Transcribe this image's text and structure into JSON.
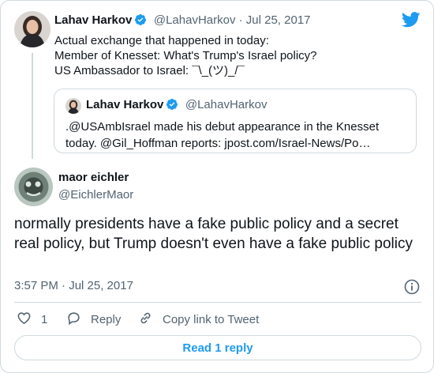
{
  "colors": {
    "accent": "#1d9bf0",
    "muted": "#536471",
    "border": "#cfd9de"
  },
  "parent": {
    "author_name": "Lahav Harkov",
    "handle_date": "@LahavHarkov · Jul 25, 2017",
    "lines": [
      "Actual exchange that happened in today:",
      "Member of Knesset: What's Trump's Israel policy?",
      "US Ambassador to Israel: ¯\\_(ツ)_/¯"
    ]
  },
  "quoted": {
    "author_name": "Lahav Harkov",
    "handle": "@LahavHarkov",
    "lines": [
      ".@USAmbIsrael made his debut appearance in the Knesset",
      "today. @Gil_Hoffman reports: jpost.com/Israel-News/Po…"
    ]
  },
  "tweet": {
    "author_name": "maor eichler",
    "handle": "@EichlerMaor",
    "text": "normally presidents have a fake public policy and a secret real policy, but Trump doesn't even have a fake public policy",
    "timestamp": "3:57 PM · Jul 25, 2017"
  },
  "actions": {
    "like_count": "1",
    "reply_label": "Reply",
    "copy_link_label": "Copy link to Tweet"
  },
  "read_replies_label": "Read 1 reply",
  "icons": [
    "twitter-bird-icon",
    "verified-badge-icon",
    "info-icon",
    "heart-icon",
    "reply-icon",
    "link-icon"
  ]
}
